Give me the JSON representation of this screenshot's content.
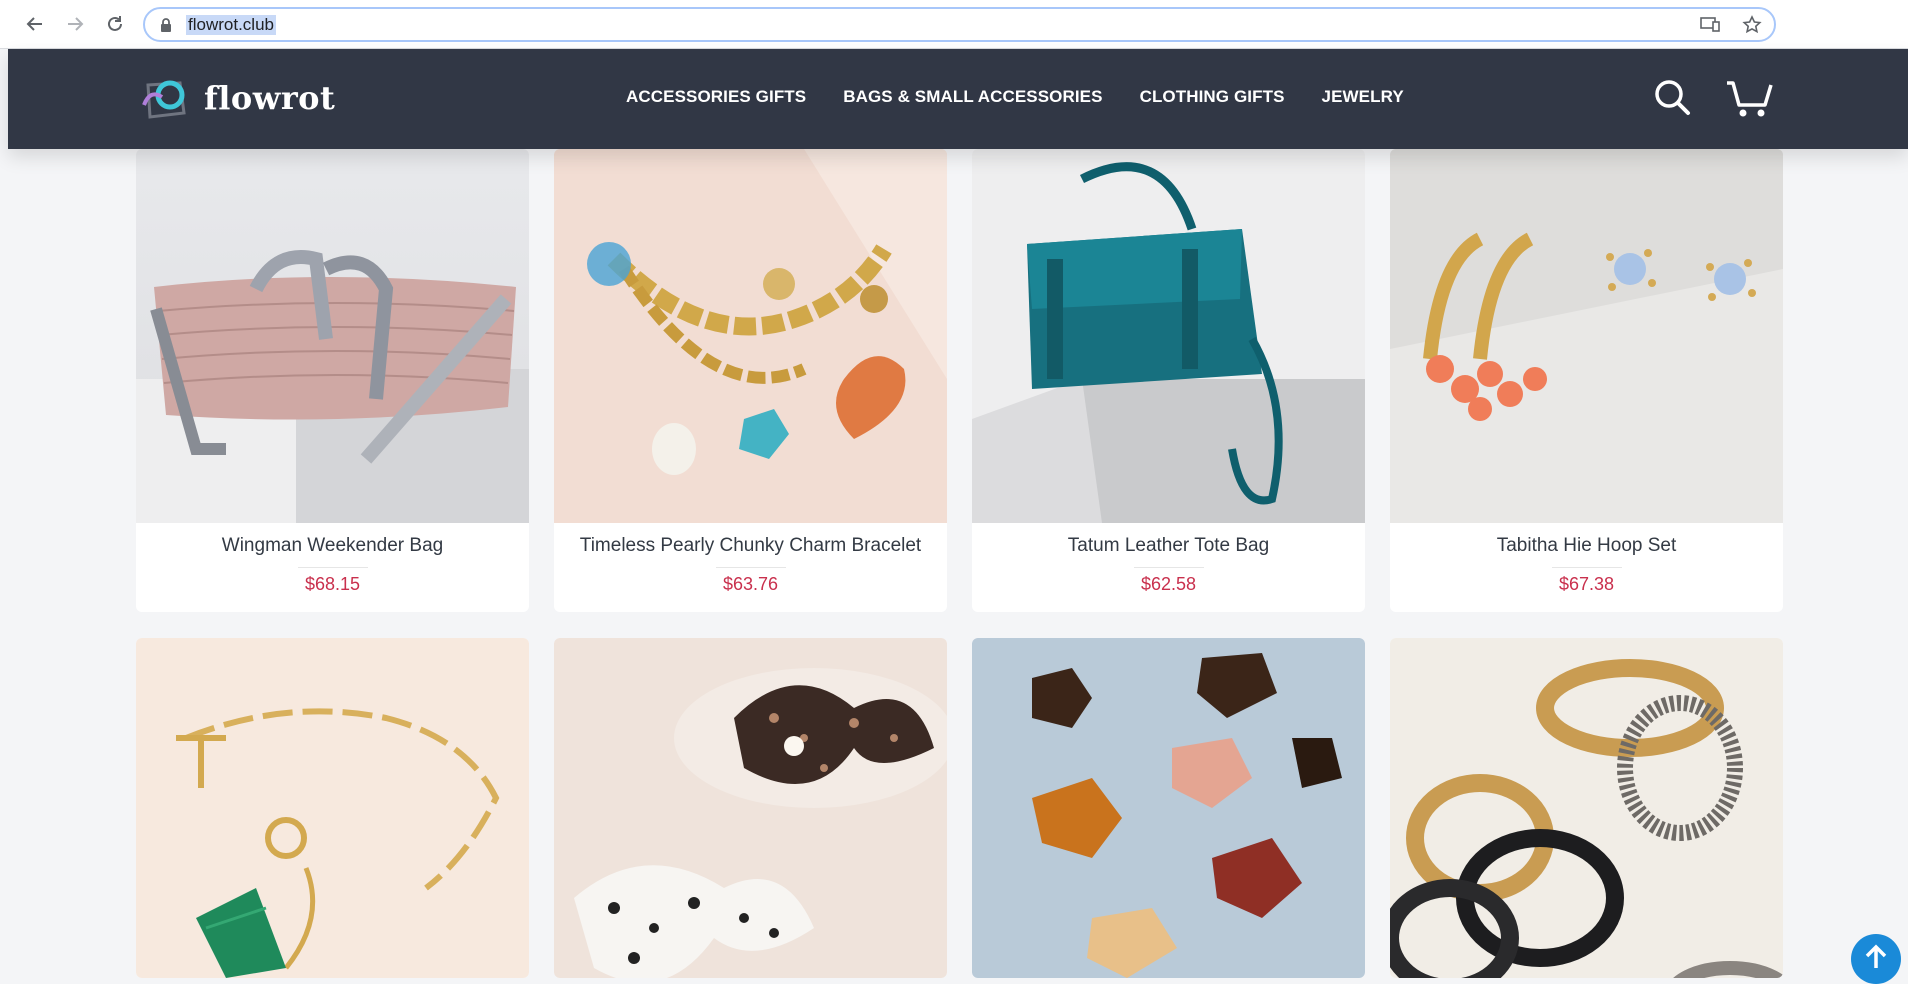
{
  "browser": {
    "url": "flowrot.club",
    "icons": [
      "back-arrow-icon",
      "forward-arrow-icon",
      "reload-icon",
      "lock-icon",
      "install-app-icon",
      "bookmark-star-icon"
    ]
  },
  "site": {
    "logo_text": "flowrot",
    "menu": [
      "ACCESSORIES GIFTS",
      "BAGS & SMALL ACCESSORIES",
      "CLOTHING GIFTS",
      "JEWELRY"
    ],
    "colors": {
      "header_bg": "#313745",
      "price": "#c9304d",
      "accent": "#1a8ad8"
    }
  },
  "products": [
    {
      "name": "Wingman Weekender Bag",
      "price": "$68.15"
    },
    {
      "name": "Timeless Pearly Chunky Charm Bracelet",
      "price": "$63.76"
    },
    {
      "name": "Tatum Leather Tote Bag",
      "price": "$62.58"
    },
    {
      "name": "Tabitha Hie Hoop Set",
      "price": "$67.38"
    },
    {
      "name": "",
      "price": ""
    },
    {
      "name": "",
      "price": ""
    },
    {
      "name": "",
      "price": ""
    },
    {
      "name": "",
      "price": ""
    }
  ]
}
